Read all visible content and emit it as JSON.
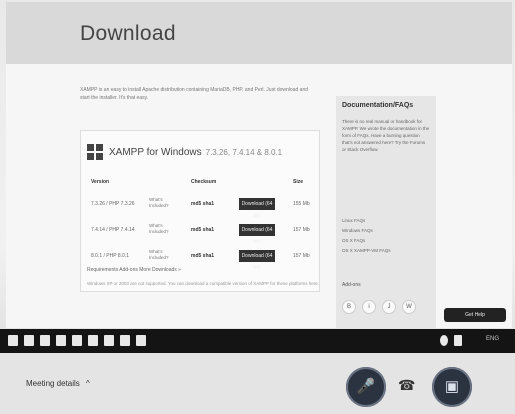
{
  "page": {
    "title": "Download",
    "intro_text": "XAMPP is an easy to install Apache distribution containing MariaDB, PHP, and Perl. Just download and start the installer. It's that easy."
  },
  "windows_card": {
    "title": "XAMPP for Windows",
    "versions": "7.3.26, 7.4.14 & 8.0.1",
    "columns": [
      "Version",
      "Checksum",
      "Size"
    ],
    "rows": [
      {
        "version": "7.3.26 / PHP 7.3.26",
        "notes": "What's Included?",
        "hash": "md5 sha1",
        "button": "Download (64 bit)",
        "size": "155 Mb"
      },
      {
        "version": "7.4.14 / PHP 7.4.14",
        "notes": "What's Included?",
        "hash": "md5 sha1",
        "button": "Download (64 bit)",
        "size": "157 Mb"
      },
      {
        "version": "8.0.1 / PHP 8.0.1",
        "notes": "What's Included?",
        "hash": "md5 sha1",
        "button": "Download (64 bit)",
        "size": "157 Mb"
      }
    ],
    "footer_links": "Requirements   Add-ons   More Downloads »",
    "footer_note": "Windows XP or 2003 are not supported. You can download a compatible version of XAMPP for these platforms here."
  },
  "sidebar": {
    "title": "Documentation/FAQs",
    "text": "There is no real manual or handbook for XAMPP. We wrote the documentation in the form of FAQs. Have a burning question that's not answered here? Try the Forums or Stack Overflow.",
    "links": [
      "Linux FAQs",
      "Windows FAQs",
      "OS X FAQs",
      "OS X XAMPP-VM FAQs"
    ],
    "subheading": "Add-ons",
    "social_icons": [
      "B",
      "i",
      "J",
      "W"
    ],
    "chat_button": "Get Help"
  },
  "taskbar": {
    "tray_text": "ENG"
  },
  "bottom": {
    "label": "Meeting details",
    "chevron": "^"
  },
  "colors": {
    "taskbar": "#141414",
    "download_button": "#333333",
    "call_button": "#2b3340"
  }
}
